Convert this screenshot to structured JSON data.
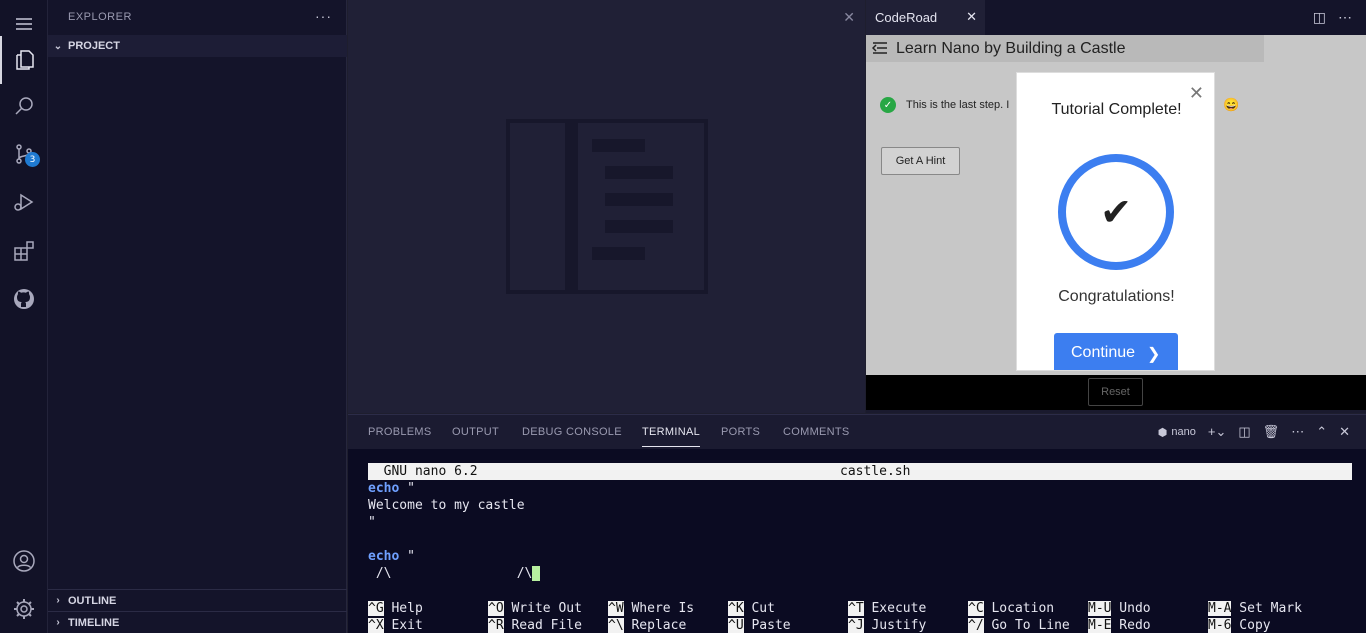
{
  "activity_bar": {
    "scm_badge": "3"
  },
  "sidebar": {
    "title": "EXPLORER",
    "more": "···",
    "project": "PROJECT",
    "outline": "OUTLINE",
    "timeline": "TIMELINE"
  },
  "coderoad": {
    "tab_label": "CodeRoad",
    "header_title": "Learn Nano by Building a Castle",
    "step_text": "This is the last step. I",
    "hint_button": "Get A Hint",
    "reset_button": "Reset",
    "modal": {
      "title": "Tutorial Complete!",
      "message": "Congratulations!",
      "continue_button": "Continue"
    }
  },
  "panel": {
    "tabs": [
      "PROBLEMS",
      "OUTPUT",
      "DEBUG CONSOLE",
      "TERMINAL",
      "PORTS",
      "COMMENTS"
    ],
    "active_tab": "TERMINAL",
    "terminal_name": "nano"
  },
  "terminal": {
    "header_left": "  GNU nano 6.2",
    "header_filename": "castle.sh",
    "lines": {
      "l1_kw": "echo",
      "l1_rest": " \"",
      "l2": "Welcome to my castle",
      "l3": "\"",
      "l5_kw": "echo",
      "l5_rest": " \"",
      "l6": " /\\                /\\"
    },
    "shortcuts_row1": [
      {
        "key": "^G",
        "label": " Help"
      },
      {
        "key": "^O",
        "label": " Write Out"
      },
      {
        "key": "^W",
        "label": " Where Is"
      },
      {
        "key": "^K",
        "label": " Cut"
      },
      {
        "key": "^T",
        "label": " Execute"
      },
      {
        "key": "^C",
        "label": " Location"
      },
      {
        "key": "M-U",
        "label": " Undo"
      },
      {
        "key": "M-A",
        "label": " Set Mark"
      }
    ],
    "shortcuts_row2": [
      {
        "key": "^X",
        "label": " Exit"
      },
      {
        "key": "^R",
        "label": " Read File"
      },
      {
        "key": "^\\",
        "label": " Replace"
      },
      {
        "key": "^U",
        "label": " Paste"
      },
      {
        "key": "^J",
        "label": " Justify"
      },
      {
        "key": "^/",
        "label": " Go To Line"
      },
      {
        "key": "M-E",
        "label": " Redo"
      },
      {
        "key": "M-6",
        "label": " Copy"
      }
    ]
  },
  "colors": {
    "accent": "#3c7ef0",
    "badge": "#1f7ad1",
    "success": "#28a745",
    "keyword": "#6fa0ff"
  }
}
